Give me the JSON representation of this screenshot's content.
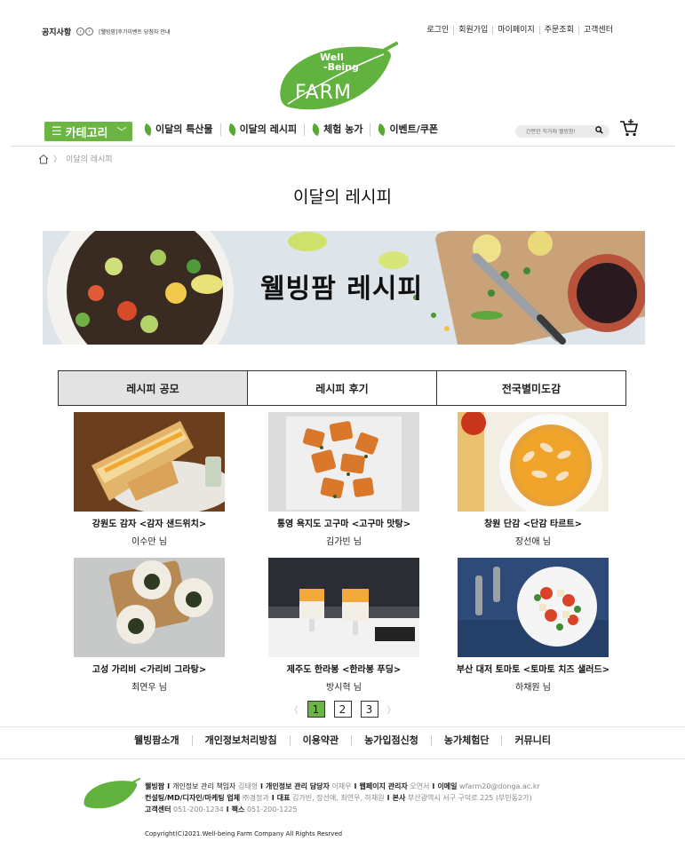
{
  "topbar": {
    "notice_title": "공지사항",
    "notice_text": "[웰빙팜]후기이벤트 당첨자 안내",
    "util_links": [
      "로그인",
      "회원가입",
      "마이페이지",
      "주문조회",
      "고객센터"
    ]
  },
  "logo": {
    "line1": "Well",
    "line2": "-Being",
    "line3": "FARM"
  },
  "nav": {
    "category_label": "카테고리",
    "menu": [
      "이달의 특산물",
      "이달의 레시피",
      "체험 농가",
      "이벤트/쿠폰"
    ],
    "search_placeholder": "간편한 직거래 웰빙팜!",
    "accent": "#6cb544"
  },
  "breadcrumb": {
    "current": "이달의 레시피"
  },
  "page_title": "이달의 레시피",
  "banner": {
    "title": "웰빙팜 레시피"
  },
  "tabs": [
    "레시피 공모",
    "레시피 후기",
    "전국별미도감"
  ],
  "recipes": [
    {
      "title": "강원도 감자 <감자 샌드위치>",
      "author": "이수만 님"
    },
    {
      "title": "통영 욕지도 고구마 <고구마 맛탕>",
      "author": "김가빈 님"
    },
    {
      "title": "창원 단감 <단감 타르트>",
      "author": "장선애 님"
    },
    {
      "title": "고성 가리비 <가리비 그라탕>",
      "author": "최연우 님"
    },
    {
      "title": "제주도 한라봉 <한라봉 푸딩>",
      "author": "방시혁 님"
    },
    {
      "title": "부산 대저 토마토 <토마토 치즈 샐러드>",
      "author": "하채원 님"
    }
  ],
  "pager": {
    "prev": "〈",
    "pages": [
      "1",
      "2",
      "3"
    ],
    "next": "〉",
    "current": "1"
  },
  "footer": {
    "links": [
      "웰빙팜소개",
      "개인정보처리방침",
      "이용약관",
      "농가입점신청",
      "농가체험단",
      "커뮤니티"
    ],
    "info": {
      "company_label": "웰빙팜",
      "privacy_officer_label": "개인정보 관리 책임자",
      "privacy_officer": "김태형",
      "privacy_manager_label": "개인정보 관리 담당자",
      "privacy_manager": "이재우",
      "web_admin_label": "웹페이지 관리자",
      "web_admin": "오연서",
      "email_label": "이메일",
      "email": "wfarm20@donga.ac.kr",
      "consulting_label": "컨설팅/MD/디자인/마케팅 업체",
      "consulting": "㈜경정과",
      "ceo_label": "대표",
      "ceo": "김가빈, 장선애, 최연우, 하채원",
      "hq_label": "본사",
      "hq": "부산광역시 서구 구덕로 225 (부민동2가)",
      "cs_label": "고객센터",
      "cs": "051-200-1234",
      "fax_label": "팩스",
      "fax": "051-200-1225"
    },
    "copyright": "Copyright(C)2021.Well-being Farm Company All Rights Resrved"
  }
}
